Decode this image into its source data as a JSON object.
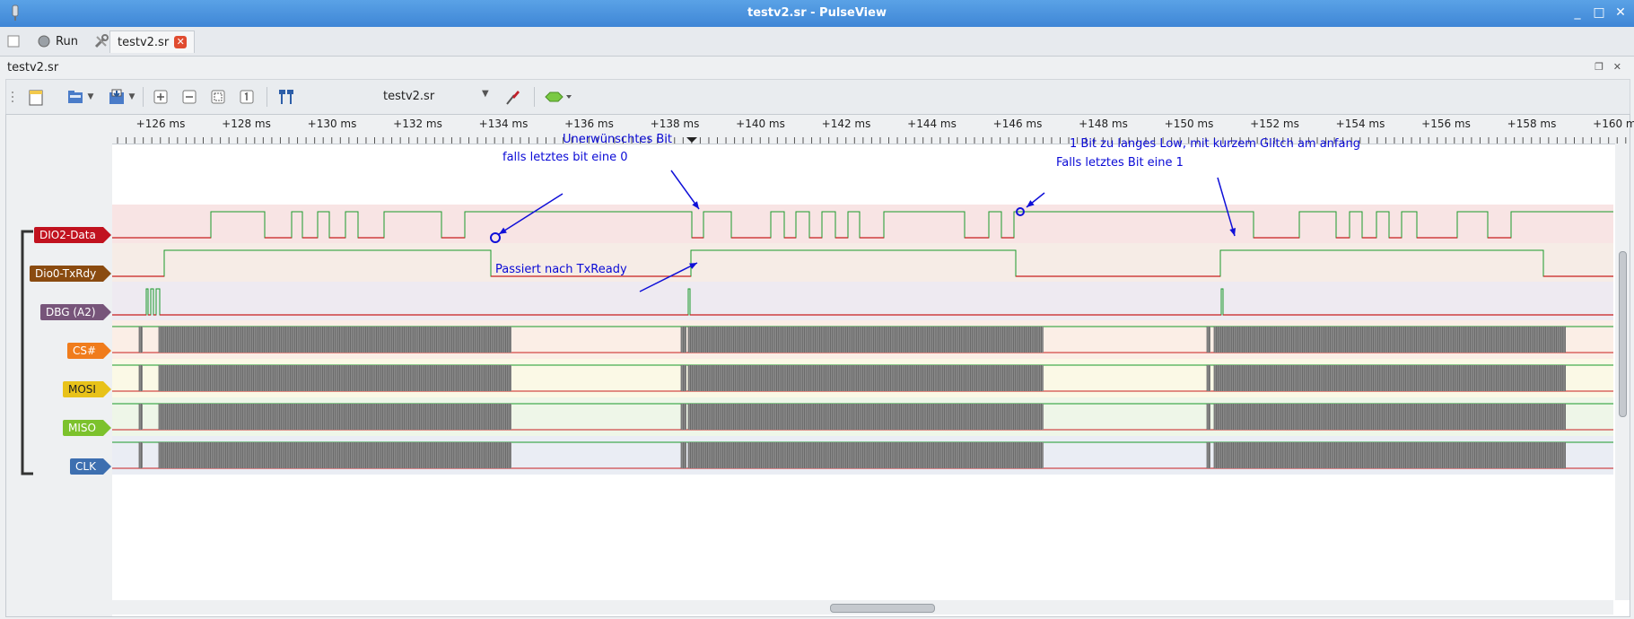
{
  "window": {
    "title": "testv2.sr - PulseView",
    "controls": [
      "_",
      "□",
      "✕"
    ]
  },
  "tabbar": {
    "run_label": "Run",
    "session_tab": "testv2.sr",
    "close_glyph": "✕"
  },
  "session": {
    "label": "testv2.sr"
  },
  "toolbar": {
    "device_name": "testv2.sr",
    "dropdown_glyph": "▼"
  },
  "ruler": {
    "ticks": [
      "+126 ms",
      "+128 ms",
      "+130 ms",
      "+132 ms",
      "+134 ms",
      "+136 ms",
      "+138 ms",
      "+140 ms",
      "+142 ms",
      "+144 ms",
      "+146 ms",
      "+148 ms",
      "+150 ms",
      "+152 ms",
      "+154 ms",
      "+156 ms",
      "+158 ms",
      "+160 ms"
    ]
  },
  "channels": [
    {
      "name": "DIO2-Data",
      "color": "#c1121f"
    },
    {
      "name": "Dio0-TxRdy",
      "color": "#8a4b10"
    },
    {
      "name": "DBG (A2)",
      "color": "#77557a"
    },
    {
      "name": "CS#",
      "color": "#f07c1c"
    },
    {
      "name": "MOSI",
      "color": "#e8c21a"
    },
    {
      "name": "MISO",
      "color": "#7cc22c"
    },
    {
      "name": "CLK",
      "color": "#3d6fb0"
    }
  ],
  "annotations": {
    "a1": "Unerwünschtes Bit",
    "a2": "falls letztes bit eine 0",
    "a3": "1 Bit zu langes Low, mit kurzem Glitch am anfang",
    "a4": "Falls letztes Bit eine 1",
    "a5": "Passiert nach TxReady"
  }
}
